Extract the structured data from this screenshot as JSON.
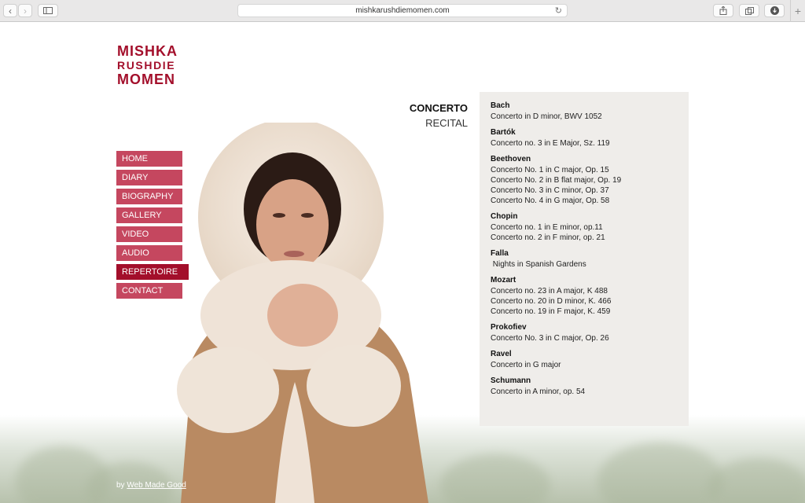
{
  "browser": {
    "url": "mishkarushdiemomen.com"
  },
  "site": {
    "name_line1": "MISHKA",
    "name_line2": "RUSHDIE",
    "name_line3": "MOMEN"
  },
  "nav": [
    {
      "label": "HOME"
    },
    {
      "label": "DIARY"
    },
    {
      "label": "BIOGRAPHY"
    },
    {
      "label": "GALLERY"
    },
    {
      "label": "VIDEO"
    },
    {
      "label": "AUDIO"
    },
    {
      "label": "REPERTOIRE",
      "active": true
    },
    {
      "label": "CONTACT"
    }
  ],
  "modes": {
    "concerto": "CONCERTO",
    "recital": "RECITAL"
  },
  "repertoire": [
    {
      "composer": "Bach",
      "works": [
        "Concerto in D minor, BWV 1052"
      ]
    },
    {
      "composer": "Bartók",
      "works": [
        "Concerto no. 3 in E Major, Sz. 119"
      ]
    },
    {
      "composer": "Beethoven",
      "works": [
        "Concerto No. 1 in C major, Op. 15",
        "Concerto No. 2 in B flat major, Op. 19",
        "Concerto No. 3 in C minor, Op. 37",
        "Concerto No. 4 in G major, Op. 58"
      ]
    },
    {
      "composer": "Chopin",
      "works": [
        "Concerto no. 1 in E minor, op.11",
        "Concerto no. 2 in F minor, op. 21"
      ]
    },
    {
      "composer": "Falla",
      "works": [
        " Nights in Spanish Gardens"
      ]
    },
    {
      "composer": "Mozart",
      "works": [
        "Concerto no. 23 in A major, K 488",
        "Concerto no. 20 in D minor, K. 466",
        "Concerto no. 19 in F major, K. 459"
      ]
    },
    {
      "composer": "Prokofiev",
      "works": [
        "Concerto No. 3 in C major, Op. 26"
      ]
    },
    {
      "composer": "Ravel",
      "works": [
        "Concerto in G major"
      ]
    },
    {
      "composer": "Schumann",
      "works": [
        "Concerto in A minor, op. 54"
      ]
    }
  ],
  "footer": {
    "by": "by",
    "link": "Web Made Good"
  },
  "colors": {
    "brand": "#a30f2b",
    "nav": "#c5475f",
    "panel": "#efedea"
  },
  "icons": {
    "back": "chevron-left-icon",
    "forward": "chevron-right-icon",
    "sidebar": "sidebar-icon",
    "reload": "reload-icon",
    "share": "share-icon",
    "tabs": "tabs-icon",
    "download": "download-icon",
    "new_tab": "plus-icon"
  }
}
